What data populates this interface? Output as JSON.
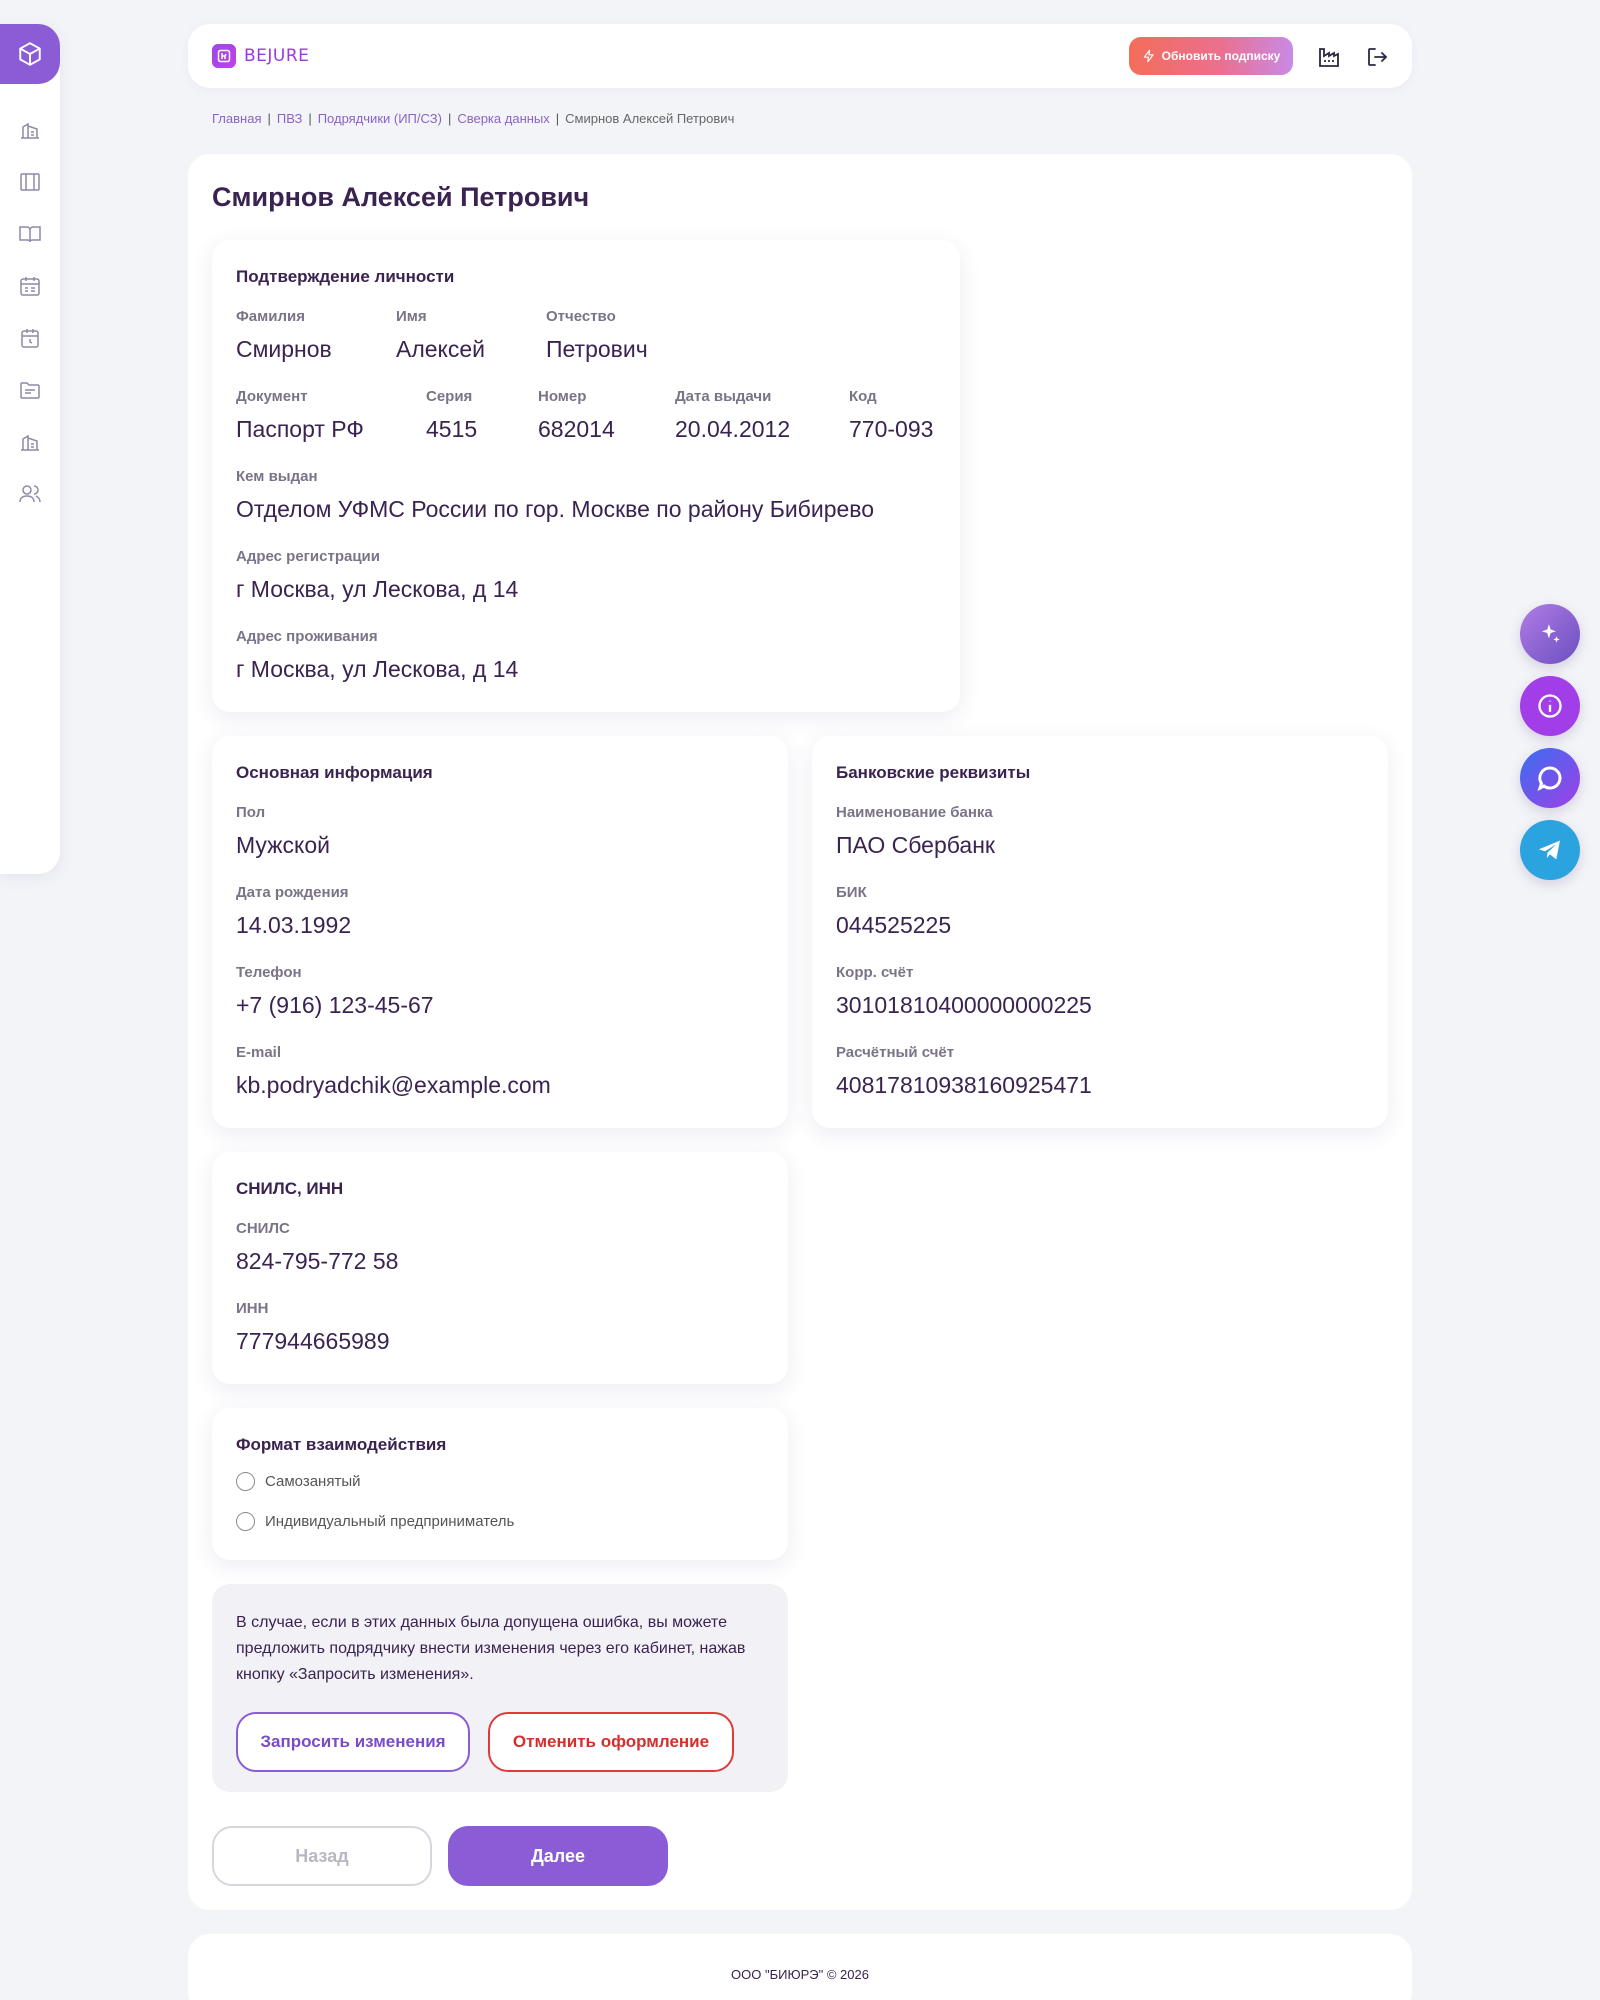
{
  "header": {
    "logo_text": "BEJURE",
    "subscribe_label": "Обновить подписку"
  },
  "breadcrumb": [
    "Главная",
    "ПВЗ",
    "Подрядчики (ИП/СЗ)",
    "Сверка данных",
    "Смирнов Алексей Петрович"
  ],
  "page": {
    "title": "Смирнов Алексей Петрович"
  },
  "identity": {
    "title": "Подтверждение личности",
    "last_name_label": "Фамилия",
    "last_name": "Смирнов",
    "first_name_label": "Имя",
    "first_name": "Алексей",
    "patronymic_label": "Отчество",
    "patronymic": "Петрович",
    "document_label": "Документ",
    "document": "Паспорт РФ",
    "series_label": "Серия",
    "series": "4515",
    "number_label": "Номер",
    "number": "682014",
    "issue_date_label": "Дата выдачи",
    "issue_date": "20.04.2012",
    "code_label": "Код",
    "code": "770-093",
    "issued_by_label": "Кем выдан",
    "issued_by": "Отделом УФМС России по гор. Москве по району Бибирево",
    "reg_address_label": "Адрес регистрации",
    "reg_address": "г Москва, ул Лескова, д 14",
    "live_address_label": "Адрес проживания",
    "live_address": "г Москва, ул Лескова, д 14"
  },
  "basic": {
    "title": "Основная информация",
    "gender_label": "Пол",
    "gender": "Мужской",
    "birth_label": "Дата рождения",
    "birth": "14.03.1992",
    "phone_label": "Телефон",
    "phone": "+7 (916) 123-45-67",
    "email_label": "E-mail",
    "email": "kb.podryadchik@example.com"
  },
  "bank": {
    "title": "Банковские реквизиты",
    "bank_name_label": "Наименование банка",
    "bank_name": "ПАО Сбербанк",
    "bik_label": "БИК",
    "bik": "044525225",
    "corr_label": "Корр. счёт",
    "corr": "30101810400000000225",
    "account_label": "Расчётный счёт",
    "account": "40817810938160925471"
  },
  "snils": {
    "title": "СНИЛС, ИНН",
    "snils_label": "СНИЛС",
    "snils": "824-795-772 58",
    "inn_label": "ИНН",
    "inn": "777944665989"
  },
  "format": {
    "title": "Формат взаимодействия",
    "options": [
      "Самозанятый",
      "Индивидуальный предприниматель"
    ]
  },
  "note": {
    "text": "В случае, если в этих данных была допущена ошибка, вы можете предложить подрядчику внести изменения через его кабинет, нажав кнопку «Запросить изменения».",
    "request_label": "Запросить изменения",
    "cancel_label": "Отменить оформление"
  },
  "nav": {
    "back_label": "Назад",
    "next_label": "Далее"
  },
  "footer": {
    "text": "ООО \"БИЮРЭ\" © 2026"
  },
  "colors": {
    "accent": "#8a5cd6",
    "danger": "#e03b3b",
    "text": "#3a2350"
  },
  "icons": {
    "sidebar": [
      "box-icon",
      "building-icon",
      "columns-icon",
      "book-icon",
      "calendar-icon",
      "calendar-clock-icon",
      "folder-icon",
      "warehouse-icon",
      "users-icon"
    ],
    "header": [
      "factory-icon",
      "logout-icon"
    ],
    "floating": [
      "sparkle-icon",
      "info-icon",
      "chat-icon",
      "telegram-icon"
    ]
  }
}
